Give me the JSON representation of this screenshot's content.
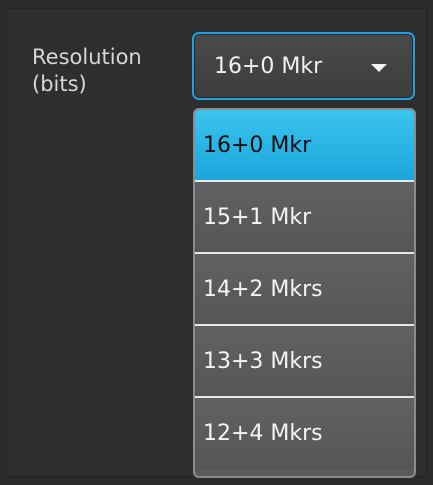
{
  "field": {
    "label_line1": "Resolution",
    "label_line2": "(bits)"
  },
  "select": {
    "current_value": "16+0 Mkr",
    "selected_index": 0
  },
  "options": [
    {
      "label": "16+0 Mkr"
    },
    {
      "label": "15+1 Mkr"
    },
    {
      "label": "14+2 Mkrs"
    },
    {
      "label": "13+3 Mkrs"
    },
    {
      "label": "12+4 Mkrs"
    }
  ],
  "colors": {
    "accent": "#1ea1df",
    "selected_option": "#2bb5e6",
    "option_background": "#5b5b5b",
    "panel_background": "#2e2e2e"
  },
  "icons": {
    "dropdown_caret": "triangle-down"
  }
}
